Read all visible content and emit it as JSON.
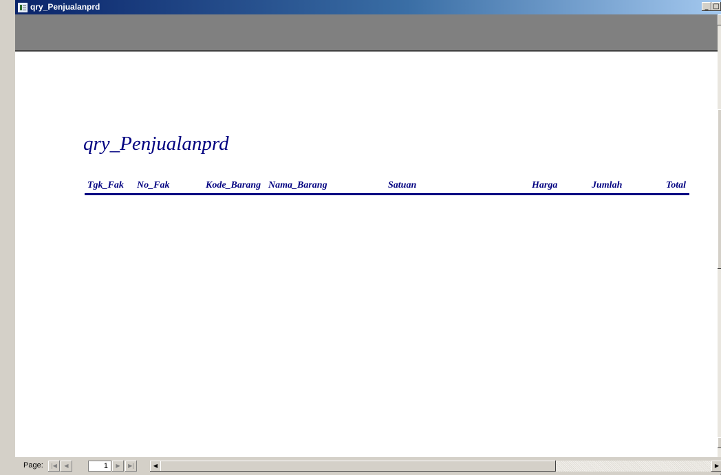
{
  "window": {
    "title": "qry_Penjualanprd",
    "min_glyph": "_",
    "max_glyph": "□",
    "close_glyph": "✕"
  },
  "report": {
    "title": "qry_Penjualanprd",
    "columns": [
      "Tgk_Fak",
      "No_Fak",
      "Kode_Barang",
      "Nama_Barang",
      "Satuan",
      "Harga",
      "Jumlah",
      "Total"
    ],
    "header_color": "#000080"
  },
  "navigation": {
    "page_label": "Page:",
    "current_page": "1",
    "first_glyph": "|◀",
    "prev_glyph": "◀",
    "next_glyph": "▶",
    "last_glyph": "▶|"
  },
  "scroll": {
    "up_glyph": "▲",
    "down_glyph": "▼",
    "left_glyph": "◀",
    "right_glyph": "▶"
  }
}
